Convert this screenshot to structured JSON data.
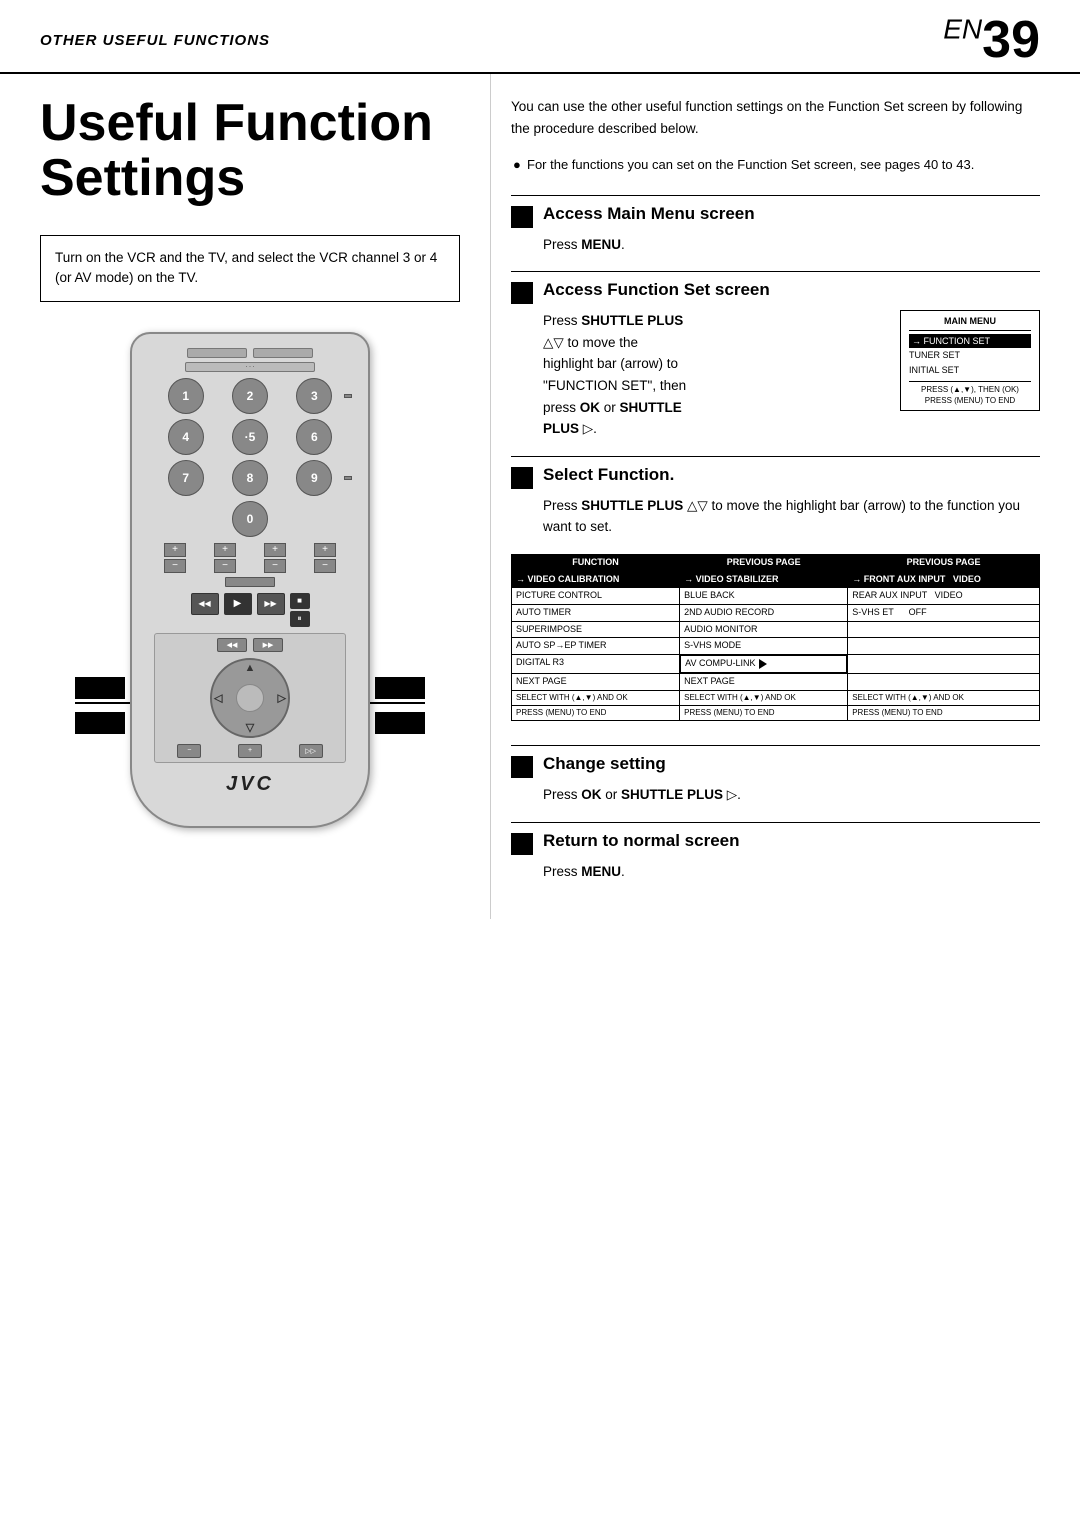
{
  "header": {
    "section_label": "OTHER USEFUL FUNCTIONS",
    "page_en": "EN",
    "page_number": "39"
  },
  "page_title": "Useful Function Settings",
  "intro_box": {
    "text": "Turn on the VCR and the TV, and select the VCR channel 3 or 4 (or AV mode) on the TV."
  },
  "intro_text": "You can use the other useful function settings on the Function Set screen by following the procedure described below.",
  "bullet_text": "For the functions you can set on the Function Set screen, see pages 40 to 43.",
  "steps": [
    {
      "id": 1,
      "title": "Access Main Menu screen",
      "body": "Press MENU.",
      "body_bold": "MENU"
    },
    {
      "id": 2,
      "title": "Access Function Set screen",
      "body_intro": "Press SHUTTLE PLUS",
      "body_detail": "△▽ to move the highlight bar (arrow) to \"FUNCTION SET\", then press OK or SHUTTLE PLUS ▷.",
      "bold_parts": [
        "SHUTTLE PLUS",
        "OK",
        "SHUTTLE PLUS",
        "▷"
      ]
    },
    {
      "id": 3,
      "title": "Select Function.",
      "body": "Press SHUTTLE PLUS △▽ to move the highlight bar (arrow) to the function you want to set."
    },
    {
      "id": 4,
      "title": "Change setting",
      "body": "Press OK or SHUTTLE PLUS ▷."
    },
    {
      "id": 5,
      "title": "Return to normal screen",
      "body": "Press MENU."
    }
  ],
  "menu_screen": {
    "title": "MAIN MENU",
    "items": [
      {
        "label": "→ FUNCTION SET",
        "highlighted": true
      },
      {
        "label": "TUNER SET",
        "highlighted": false
      },
      {
        "label": "INITIAL SET",
        "highlighted": false
      }
    ],
    "footer": "PRESS (▲,▼), THEN (OK)\nPRESS (MENU) TO END"
  },
  "function_table": {
    "columns": [
      "FUNCTION",
      "PREVIOUS PAGE",
      "PREVIOUS PAGE"
    ],
    "highlighted_rows": [
      "→ VIDEO CALIBRATION",
      "→ VIDEO STABILIZER",
      "→ FRONT AUX INPUT"
    ],
    "rows": [
      [
        "→ VIDEO CALIBRATION",
        "→ VIDEO STABILIZER",
        "→ FRONT AUX INPUT   VIDEO"
      ],
      [
        "PICTURE CONTROL",
        "BLUE BACK",
        "REAR AUX INPUT   VIDEO"
      ],
      [
        "AUTO TIMER",
        "2ND AUDIO RECORD",
        "S-VHS ET   OFF"
      ],
      [
        "SUPERIMPOSE",
        "AUDIO MONITOR",
        ""
      ],
      [
        "AUTO SP→EP TIMER",
        "S-VHS MODE",
        ""
      ],
      [
        "DIGITAL R3",
        "AV COMPU-LINK",
        ""
      ],
      [
        "NEXT PAGE",
        "NEXT PAGE",
        ""
      ]
    ],
    "footer_rows": [
      "SELECT WITH (▲,▼) AND OK  |  SELECT WITH (▲,▼) AND OK  |  SELECT WITH (▲,▼) AND OK",
      "PRESS (MENU) TO END  |  PRESS (MENU) TO END  |  PRESS (MENU) TO END"
    ]
  },
  "remote": {
    "brand": "JVC",
    "numpad": [
      "1",
      "2",
      "3",
      "4",
      "5",
      "6",
      "7",
      "8",
      "9",
      "0"
    ],
    "transport_buttons": [
      "◀◀",
      "▶",
      "▶▶",
      "■",
      "▮▮"
    ]
  }
}
